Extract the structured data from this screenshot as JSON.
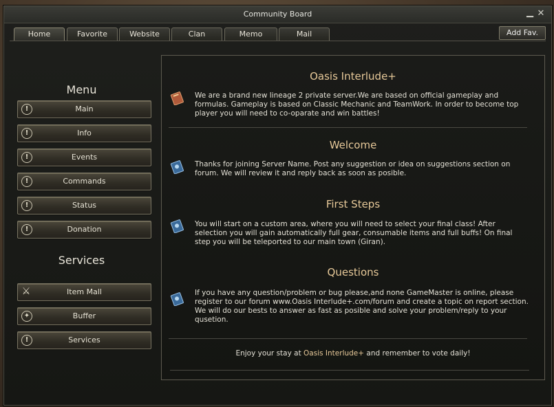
{
  "window": {
    "title": "Community Board",
    "minimize_icon": "minimize-icon",
    "close_icon": "close-icon"
  },
  "tabs": [
    {
      "label": "Home",
      "active": true
    },
    {
      "label": "Favorite"
    },
    {
      "label": "Website"
    },
    {
      "label": "Clan"
    },
    {
      "label": "Memo"
    },
    {
      "label": "Mail"
    }
  ],
  "add_fav_label": "Add Fav.",
  "sidebar": {
    "menu_title": "Menu",
    "menu_items": [
      {
        "label": "Main",
        "icon": "alert-icon"
      },
      {
        "label": "Info",
        "icon": "alert-icon"
      },
      {
        "label": "Events",
        "icon": "alert-icon"
      },
      {
        "label": "Commands",
        "icon": "alert-icon"
      },
      {
        "label": "Status",
        "icon": "alert-icon"
      },
      {
        "label": "Donation",
        "icon": "alert-icon"
      }
    ],
    "services_title": "Services",
    "service_items": [
      {
        "label": "Item Mall",
        "icon": "mall-icon"
      },
      {
        "label": "Buffer",
        "icon": "buff-icon"
      },
      {
        "label": "Services",
        "icon": "alert-icon"
      }
    ]
  },
  "content": {
    "sections": [
      {
        "title": "Oasis Interlude+",
        "icon": "red-book-icon",
        "text": "We are a brand new lineage 2 private server.We are based on official gameplay and formulas. Gameplay is based on Classic Mechanic and TeamWork. In order to become top player you will need to co-oparate and win battles!"
      },
      {
        "title": "Welcome",
        "icon": "blue-book-icon",
        "text": "Thanks for joining Server Name. Post any suggestion or idea on suggestions section on forum. We will review it and reply back as soon as posible."
      },
      {
        "title": "First Steps",
        "icon": "blue-book-icon",
        "text": "You will start on a custom area, where you will need to select your final class! After selection you will gain automatically full gear, consumable items and full buffs! On final step you will be teleported to our main town (Giran)."
      },
      {
        "title": "Questions",
        "icon": "blue-book-icon",
        "text": "If you have any question/problem or bug please,and none GameMaster is online, please register to our forum www.Oasis Interlude+.com/forum and create a topic on report section. We will do our bests to answer as fast as posible and solve your problem/reply to your qusetion."
      }
    ],
    "footer": {
      "prefix": "Enjoy your stay at ",
      "highlight": "Oasis Interlude+",
      "suffix": " and remember to vote daily!"
    }
  }
}
